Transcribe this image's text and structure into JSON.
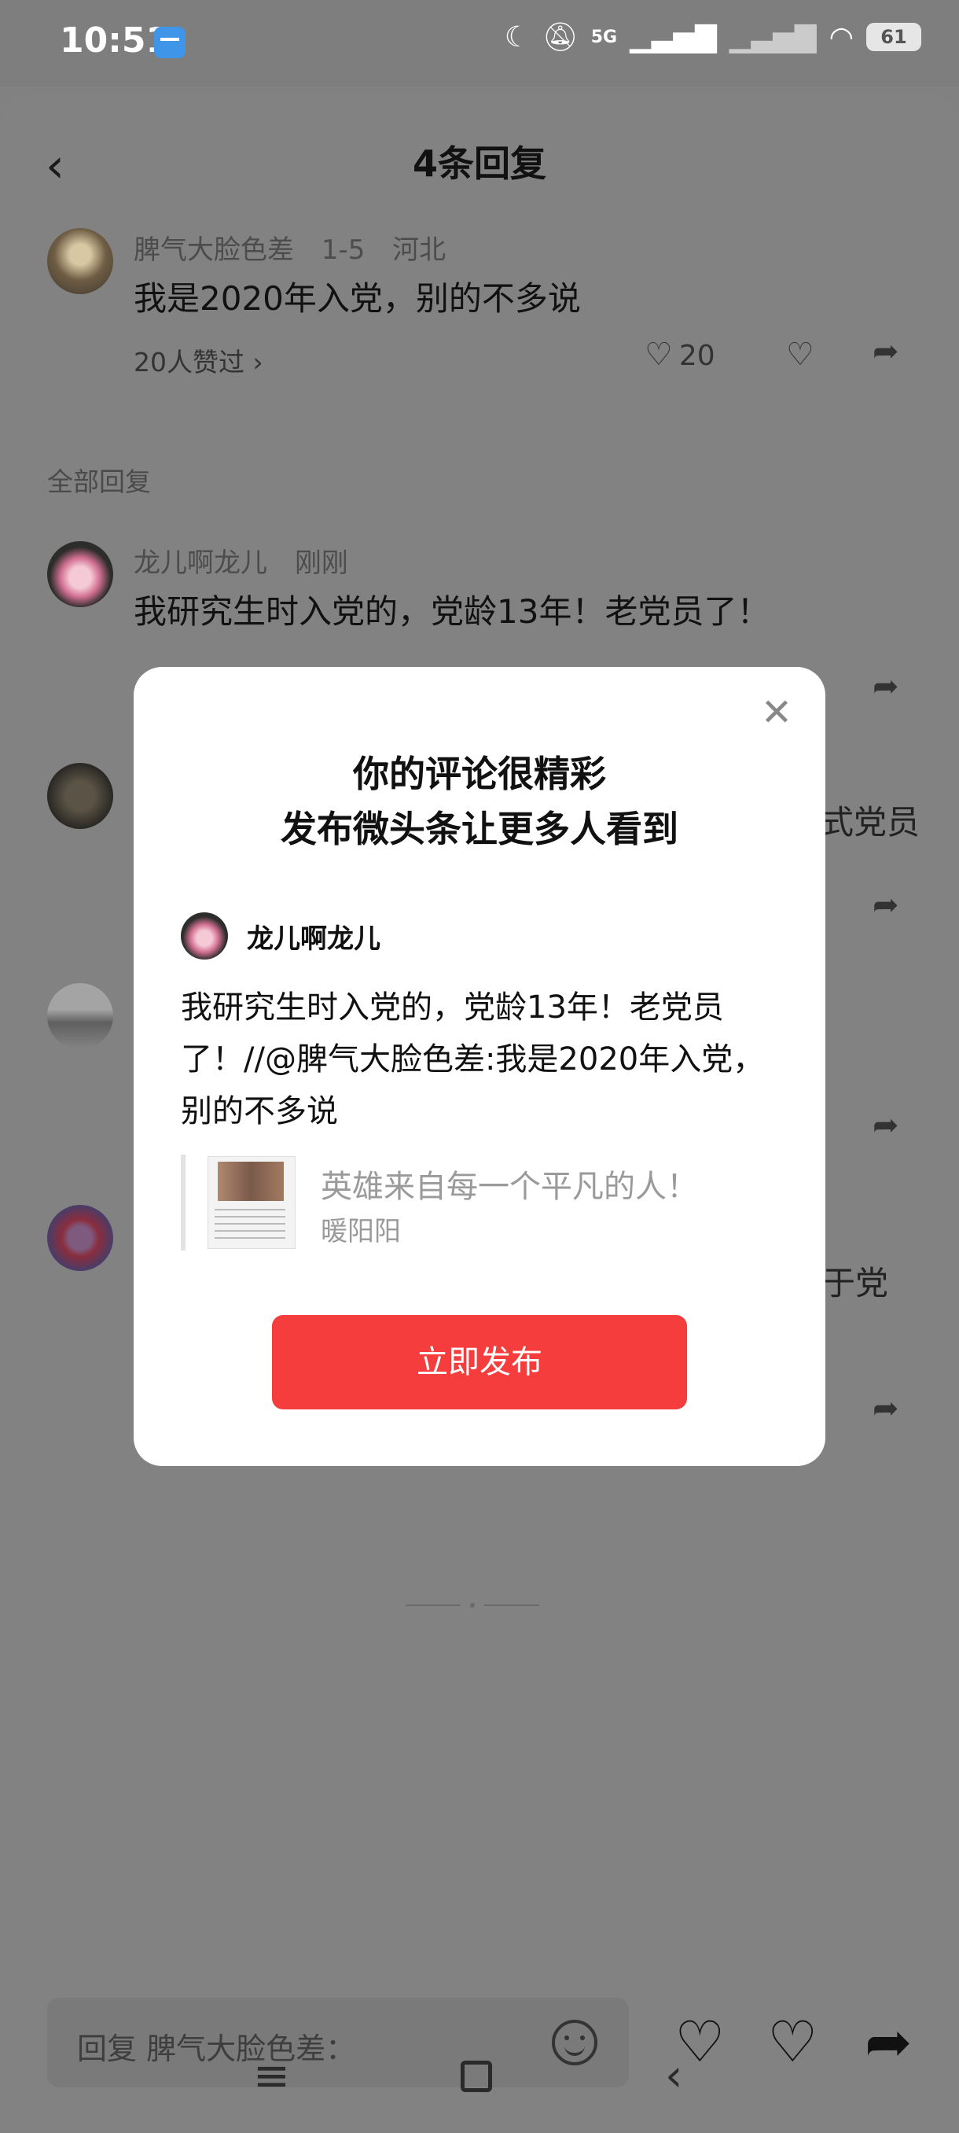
{
  "status_bar": {
    "time": "10:51",
    "battery": "61",
    "network": "5G"
  },
  "header": {
    "title": "4条回复"
  },
  "main_comment": {
    "author": "脾气大脸色差",
    "date": "1-5",
    "location": "河北",
    "text": "我是2020年入党，别的不多说",
    "likes_link": "20人赞过 ›",
    "like_count": "20"
  },
  "section_label": "全部回复",
  "replies": [
    {
      "author": "龙儿啊龙儿",
      "time": "刚刚",
      "text": "我研究生时入党的，党龄13年！老党员了！"
    },
    {
      "visible_fragment": "式党员"
    },
    {
      "visible_fragment": ""
    },
    {
      "visible_fragment": "于党"
    }
  ],
  "modal": {
    "title_line1": "你的评论很精彩",
    "title_line2": "发布微头条让更多人看到",
    "username": "龙儿啊龙儿",
    "body": "我研究生时入党的，党龄13年！老党员了！//@脾气大脸色差:我是2020年入党，别的不多说",
    "quote_title": "英雄来自每一个平凡的人！",
    "quote_source": "暖阳阳",
    "publish_label": "立即发布"
  },
  "bottom_bar": {
    "reply_placeholder": "回复 脾气大脸色差："
  },
  "icons": {
    "back": "back-arrow-icon",
    "like": "heart-icon",
    "dislike": "broken-heart-icon",
    "share": "share-icon",
    "emoji": "emoji-icon",
    "close": "close-icon"
  },
  "colors": {
    "accent": "#f53d3d",
    "overlay": "#828282"
  }
}
